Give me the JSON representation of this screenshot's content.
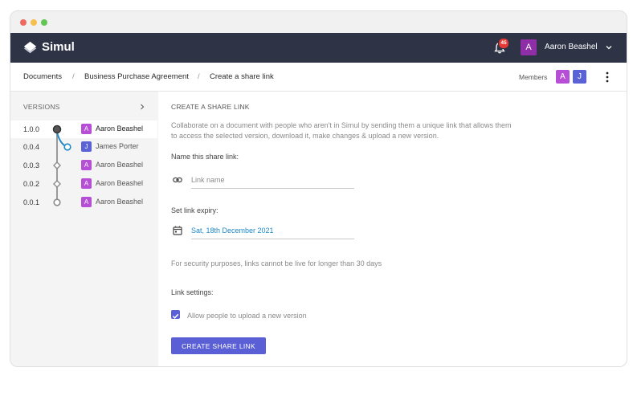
{
  "window": {
    "dots": [
      "#ee6a5f",
      "#f5be4f",
      "#62c554"
    ]
  },
  "app": {
    "name": "Simul",
    "notification_count": "45",
    "user": {
      "initial": "A",
      "name": "Aaron Beashel"
    }
  },
  "breadcrumb": [
    "Documents",
    "Business Purchase Agreement",
    "Create a share link"
  ],
  "members": {
    "label": "Members",
    "avatars": [
      {
        "initial": "A",
        "color": "#b64fd6"
      },
      {
        "initial": "J",
        "color": "#5a62d6"
      }
    ]
  },
  "versions": {
    "header": "VERSIONS",
    "items": [
      {
        "number": "1.0.0",
        "initial": "A",
        "author": "Aaron Beashel",
        "color": "#b64fd6",
        "active": true
      },
      {
        "number": "0.0.4",
        "initial": "J",
        "author": "James Porter",
        "color": "#5a62d6",
        "active": false
      },
      {
        "number": "0.0.3",
        "initial": "A",
        "author": "Aaron Beashel",
        "color": "#b64fd6",
        "active": false
      },
      {
        "number": "0.0.2",
        "initial": "A",
        "author": "Aaron Beashel",
        "color": "#b64fd6",
        "active": false
      },
      {
        "number": "0.0.1",
        "initial": "A",
        "author": "Aaron Beashel",
        "color": "#b64fd6",
        "active": false
      }
    ]
  },
  "share": {
    "title": "CREATE A SHARE LINK",
    "description": "Collaborate on a document with people who aren't in Simul by sending them a unique link that allows them to access the selected version, download it, make changes & upload a new version.",
    "name_label": "Name this share link:",
    "name_placeholder": "Link name",
    "expiry_label": "Set link expiry:",
    "expiry_value": "Sat, 18th December 2021",
    "security_note": "For security purposes, links cannot be live for longer than 30 days",
    "settings_label": "Link settings:",
    "allow_upload_label": "Allow people to upload a new version",
    "allow_upload_checked": true,
    "submit_label": "CREATE SHARE LINK"
  },
  "colors": {
    "appbar": "#2e3446",
    "accent": "#5a5fd6",
    "link_blue": "#1e88c9",
    "branch": "#1e88c9"
  }
}
